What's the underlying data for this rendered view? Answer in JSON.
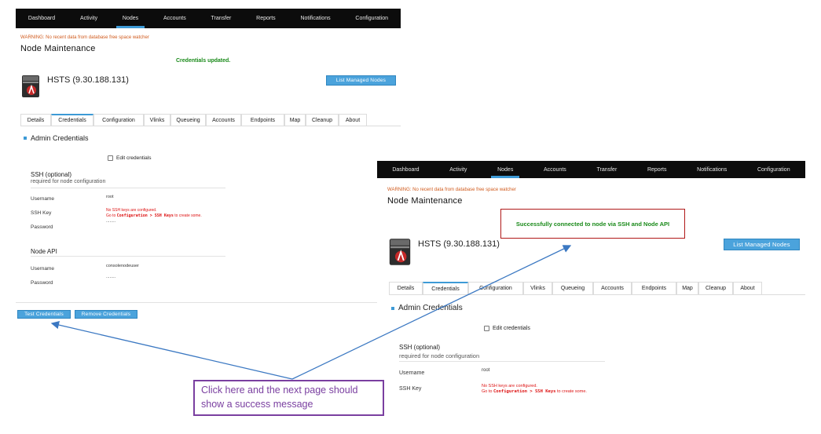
{
  "nav": {
    "items": [
      "Dashboard",
      "Activity",
      "Nodes",
      "Accounts",
      "Transfer",
      "Reports",
      "Notifications",
      "Configuration"
    ],
    "active": "Nodes"
  },
  "page": {
    "warning": "WARNING: No recent data from database free space watcher",
    "title": "Node Maintenance",
    "node_name": "HSTS (9.30.188.131)",
    "list_nodes_button": "List Managed Nodes",
    "tabs": [
      "Details",
      "Credentials",
      "Configuration",
      "Vlinks",
      "Queueing",
      "Accounts",
      "Endpoints",
      "Map",
      "Cleanup",
      "About"
    ],
    "active_tab": "Credentials",
    "section_title": "Admin Credentials",
    "edit_credentials_label": "Edit credentials",
    "ssh_title": "SSH (optional)",
    "ssh_note": "required for node configuration",
    "username_label": "Username",
    "ssh_key_label": "SSH Key",
    "password_label": "Password",
    "ssh_username_value": "root",
    "ssh_key_error_1": "No SSH keys are configured.",
    "ssh_key_error_2_prefix": "Go to ",
    "ssh_key_error_2_path": "Configuration > SSH Keys",
    "ssh_key_error_2_suffix": " to create some.",
    "password_masked": "........",
    "node_api_title": "Node API",
    "api_username_value": "consolenodeuser",
    "test_credentials_button": "Test Credentials",
    "remove_credentials_button": "Remove Credentials"
  },
  "left_screen": {
    "flash_message": "Credentials updated."
  },
  "right_screen": {
    "success_message": "Successfully connected to node via SSH and Node API"
  },
  "annotation": {
    "callout_text": "Click here and the next page should show a success message"
  },
  "colors": {
    "nav_bg": "#0c0c0c",
    "accent": "#3d9ad6",
    "button_blue": "#4ba3dc",
    "warning_orange": "#d05a1c",
    "success_green": "#1a8a1a",
    "error_red": "#d11111",
    "callout_purple": "#7a3fa0",
    "success_border": "#b01818",
    "arrow_blue": "#3b78c2"
  }
}
